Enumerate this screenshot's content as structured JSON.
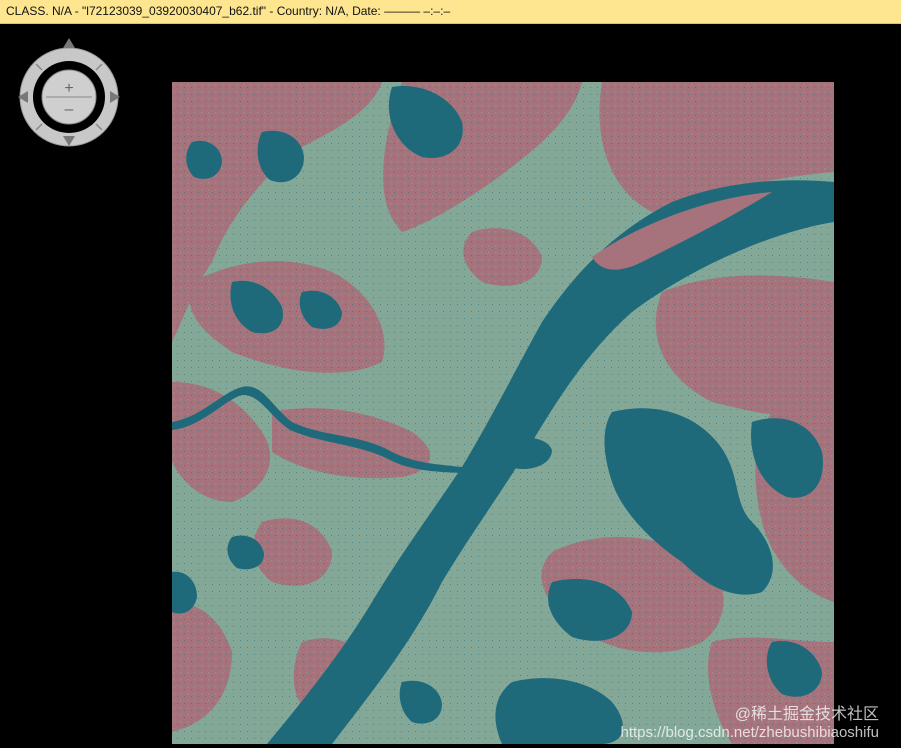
{
  "window": {
    "title": "CLASS. N/A - \"l72123039_03920030407_b62.tif\" - Country: N/A, Date: ——— –:–:–"
  },
  "nav": {
    "zoom_in": "+",
    "zoom_out": "–"
  },
  "colors": {
    "urban": "#a6737d",
    "vegetation": "#83a898",
    "water": "#1f6a7a",
    "background": "#000000",
    "titlebar": "#fde68f"
  },
  "watermark": {
    "line1": "@稀土掘金技术社区",
    "line2": "https://blog.csdn.net/zhebushibiaoshifu"
  }
}
